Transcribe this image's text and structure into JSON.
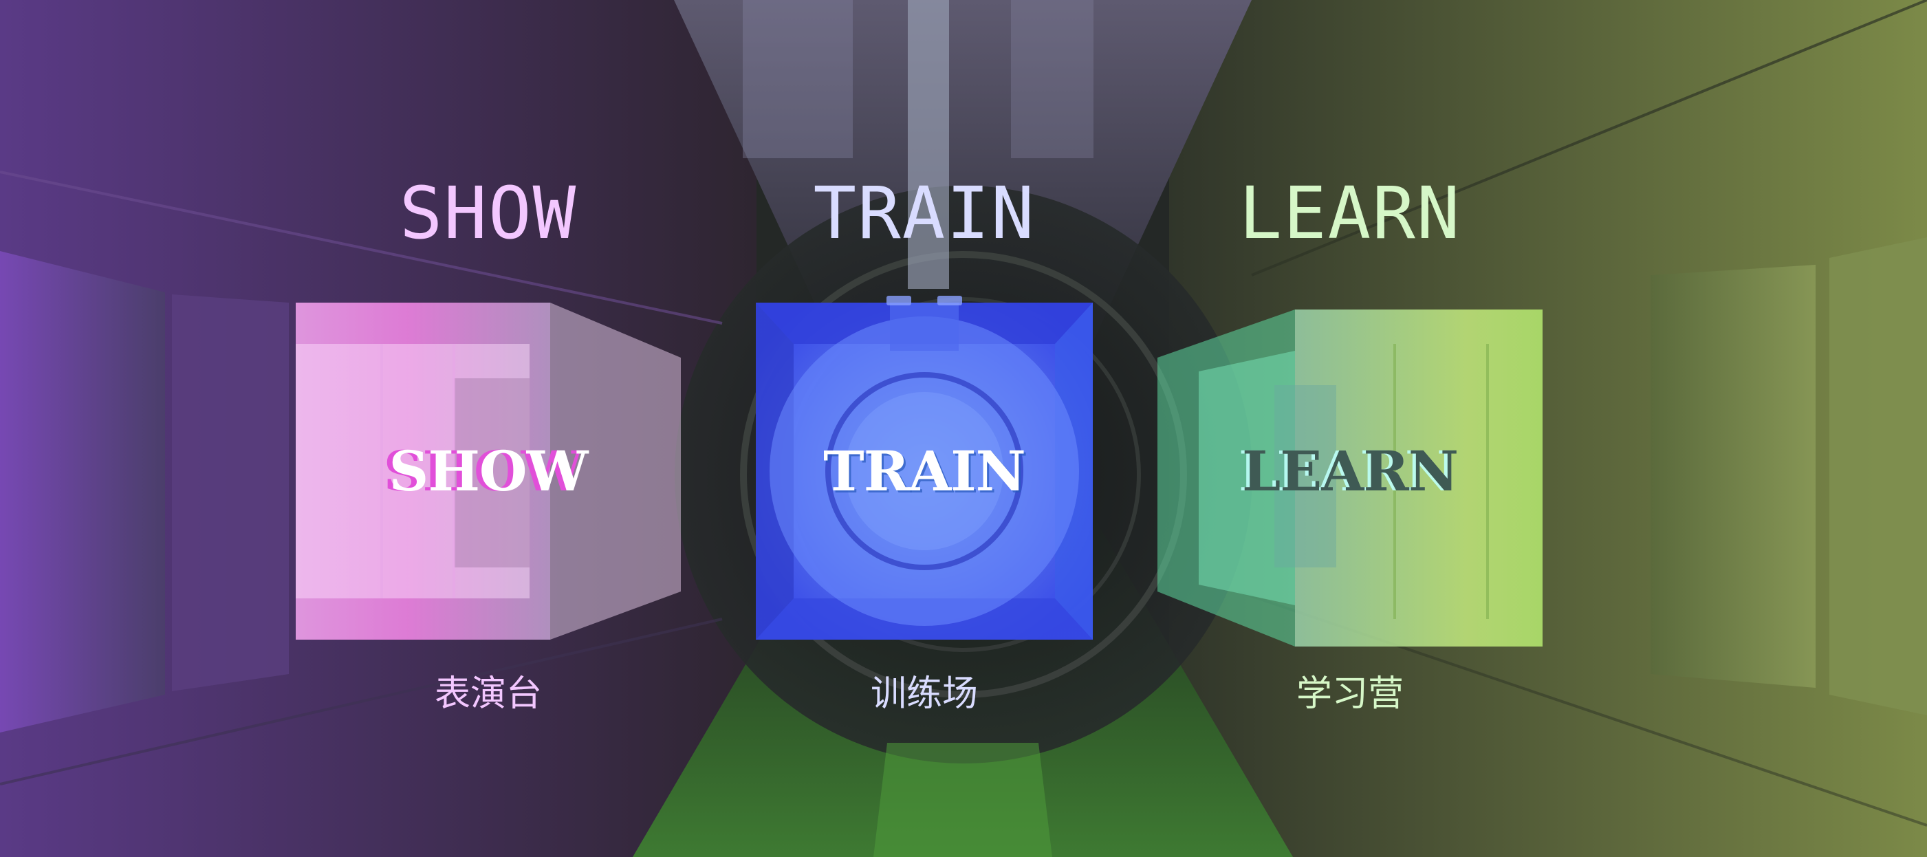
{
  "modes": {
    "show": {
      "title": "SHOW",
      "cube_label": "SHOW",
      "subtitle": "表演台"
    },
    "train": {
      "title": "TRAIN",
      "cube_label": "TRAIN",
      "subtitle": "训练场"
    },
    "learn": {
      "title": "LEARN",
      "cube_label": "LEARN",
      "subtitle": "学习营"
    }
  },
  "colors": {
    "show_accent": "#f3c7ff",
    "train_accent": "#4d6bff",
    "learn_accent": "#b8f76a"
  }
}
